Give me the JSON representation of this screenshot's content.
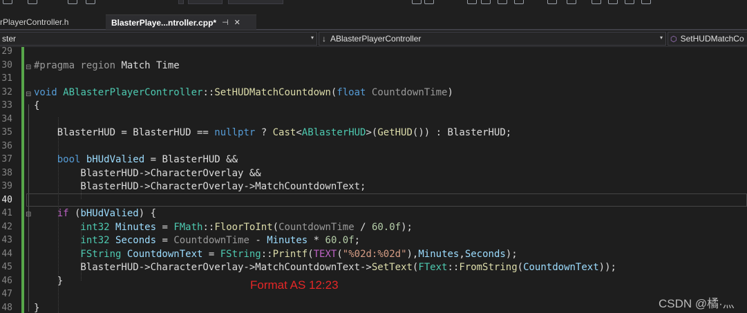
{
  "tabs": [
    {
      "label": "rPlayerController.h"
    },
    {
      "label": "BlasterPlaye...ntroller.cpp*",
      "pin": "⊣",
      "close": "✕"
    }
  ],
  "navbar": {
    "project": "ster",
    "scope": "ABlasterPlayerController",
    "member": "SetHUDMatchCo"
  },
  "editor": {
    "current_line": "40",
    "lines": [
      {
        "num": "29",
        "tokens": []
      },
      {
        "num": "30",
        "tokens": [
          {
            "c": "p",
            "t": "#pragma region "
          },
          {
            "c": "o",
            "t": "Match Time"
          }
        ]
      },
      {
        "num": "31",
        "tokens": []
      },
      {
        "num": "32",
        "tokens": [
          {
            "c": "k",
            "t": "void "
          },
          {
            "c": "t",
            "t": "ABlasterPlayerController"
          },
          {
            "c": "o",
            "t": "::"
          },
          {
            "c": "f",
            "t": "SetHUDMatchCountdown"
          },
          {
            "c": "o",
            "t": "("
          },
          {
            "c": "k",
            "t": "float "
          },
          {
            "c": "pa",
            "t": "CountdownTime"
          },
          {
            "c": "o",
            "t": ")"
          }
        ]
      },
      {
        "num": "33",
        "tokens": [
          {
            "c": "o",
            "t": "{"
          }
        ]
      },
      {
        "num": "34",
        "tokens": []
      },
      {
        "num": "35",
        "tokens": [
          {
            "c": "o",
            "t": "    BlasterHUD = BlasterHUD == "
          },
          {
            "c": "k",
            "t": "nullptr"
          },
          {
            "c": "o",
            "t": " ? "
          },
          {
            "c": "f",
            "t": "Cast"
          },
          {
            "c": "o",
            "t": "<"
          },
          {
            "c": "t",
            "t": "ABlasterHUD"
          },
          {
            "c": "o",
            "t": ">("
          },
          {
            "c": "f",
            "t": "GetHUD"
          },
          {
            "c": "o",
            "t": "()) : BlasterHUD;"
          }
        ]
      },
      {
        "num": "36",
        "tokens": []
      },
      {
        "num": "37",
        "tokens": [
          {
            "c": "k",
            "t": "    bool "
          },
          {
            "c": "lv",
            "t": "bHUdValied"
          },
          {
            "c": "o",
            "t": " = BlasterHUD &&"
          }
        ]
      },
      {
        "num": "38",
        "tokens": [
          {
            "c": "o",
            "t": "        BlasterHUD->CharacterOverlay &&"
          }
        ]
      },
      {
        "num": "39",
        "tokens": [
          {
            "c": "o",
            "t": "        BlasterHUD->CharacterOverlay->MatchCountdownText;"
          }
        ]
      },
      {
        "num": "40",
        "tokens": []
      },
      {
        "num": "41",
        "tokens": [
          {
            "c": "m",
            "t": "    if "
          },
          {
            "c": "o",
            "t": "("
          },
          {
            "c": "lv",
            "t": "bHUdValied"
          },
          {
            "c": "o",
            "t": ") {"
          }
        ]
      },
      {
        "num": "42",
        "tokens": [
          {
            "c": "t",
            "t": "        int32 "
          },
          {
            "c": "lv",
            "t": "Minutes"
          },
          {
            "c": "o",
            "t": " = "
          },
          {
            "c": "t",
            "t": "FMath"
          },
          {
            "c": "o",
            "t": "::"
          },
          {
            "c": "f",
            "t": "FloorToInt"
          },
          {
            "c": "o",
            "t": "("
          },
          {
            "c": "pa",
            "t": "CountdownTime"
          },
          {
            "c": "o",
            "t": " / "
          },
          {
            "c": "n",
            "t": "60.0f"
          },
          {
            "c": "o",
            "t": ");"
          }
        ]
      },
      {
        "num": "43",
        "tokens": [
          {
            "c": "t",
            "t": "        int32 "
          },
          {
            "c": "lv",
            "t": "Seconds"
          },
          {
            "c": "o",
            "t": " = "
          },
          {
            "c": "pa",
            "t": "CountdownTime"
          },
          {
            "c": "o",
            "t": " - "
          },
          {
            "c": "lv",
            "t": "Minutes"
          },
          {
            "c": "o",
            "t": " * "
          },
          {
            "c": "n",
            "t": "60.0f"
          },
          {
            "c": "o",
            "t": ";"
          }
        ]
      },
      {
        "num": "44",
        "tokens": [
          {
            "c": "t",
            "t": "        FString "
          },
          {
            "c": "lv",
            "t": "CountdownText"
          },
          {
            "c": "o",
            "t": " = "
          },
          {
            "c": "t",
            "t": "FString"
          },
          {
            "c": "o",
            "t": "::"
          },
          {
            "c": "f",
            "t": "Printf"
          },
          {
            "c": "o",
            "t": "("
          },
          {
            "c": "m",
            "t": "TEXT"
          },
          {
            "c": "o",
            "t": "("
          },
          {
            "c": "s",
            "t": "\"%02d:%02d\""
          },
          {
            "c": "o",
            "t": "),"
          },
          {
            "c": "lv",
            "t": "Minutes"
          },
          {
            "c": "o",
            "t": ","
          },
          {
            "c": "lv",
            "t": "Seconds"
          },
          {
            "c": "o",
            "t": ");"
          }
        ]
      },
      {
        "num": "45",
        "tokens": [
          {
            "c": "o",
            "t": "        BlasterHUD->CharacterOverlay->MatchCountdownText->"
          },
          {
            "c": "f",
            "t": "SetText"
          },
          {
            "c": "o",
            "t": "("
          },
          {
            "c": "t",
            "t": "FText"
          },
          {
            "c": "o",
            "t": "::"
          },
          {
            "c": "f",
            "t": "FromString"
          },
          {
            "c": "o",
            "t": "("
          },
          {
            "c": "lv",
            "t": "CountdownText"
          },
          {
            "c": "o",
            "t": "));"
          }
        ]
      },
      {
        "num": "46",
        "tokens": [
          {
            "c": "o",
            "t": "    }"
          }
        ]
      },
      {
        "num": "47",
        "tokens": []
      },
      {
        "num": "48",
        "tokens": [
          {
            "c": "o",
            "t": "}"
          }
        ]
      }
    ]
  },
  "annotation": "Format AS 12:23",
  "watermark": "CSDN @橘·灬",
  "icons": {
    "caret": "▾",
    "scope": "↓",
    "member": "⬡",
    "collapse": "⊟"
  }
}
